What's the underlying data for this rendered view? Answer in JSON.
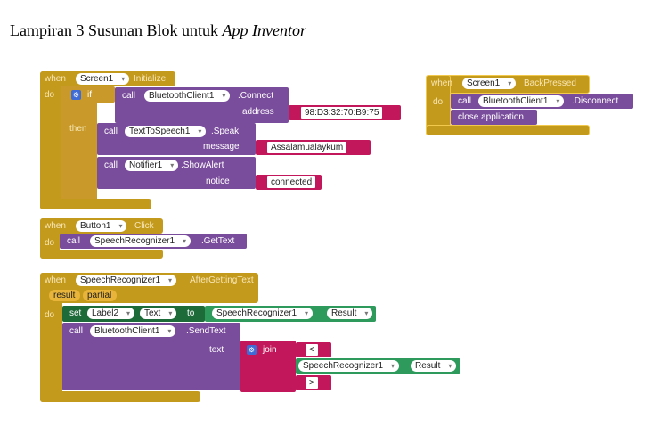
{
  "heading": {
    "prefix": "Lampiran 3 Susunan Blok untuk ",
    "italic": "App Inventor"
  },
  "block_initialize": {
    "when": "when",
    "component": "Screen1",
    "event": "Initialize",
    "do": "do",
    "if": "if",
    "then": "then",
    "connect": {
      "call": "call",
      "component": "BluetoothClient1",
      "method": ".Connect",
      "param": "address",
      "value": "98:D3:32:70:B9:75"
    },
    "speak": {
      "call": "call",
      "component": "TextToSpeech1",
      "method": ".Speak",
      "param": "message",
      "value": "Assalamualaykum"
    },
    "alert": {
      "call": "call",
      "component": "Notifier1",
      "method": ".ShowAlert",
      "param": "notice",
      "value": "connected"
    }
  },
  "block_backpressed": {
    "when": "when",
    "component": "Screen1",
    "event": "BackPressed",
    "do": "do",
    "call": "call",
    "bt_component": "BluetoothClient1",
    "bt_method": ".Disconnect",
    "close": "close application"
  },
  "block_button": {
    "when": "when",
    "component": "Button1",
    "event": "Click",
    "do": "do",
    "call": "call",
    "sr_component": "SpeechRecognizer1",
    "sr_method": ".GetText"
  },
  "block_speech": {
    "when": "when",
    "component": "SpeechRecognizer1",
    "event": "AfterGettingText",
    "param1": "result",
    "param2": "partial",
    "do": "do",
    "set": "set",
    "label": "Label2",
    "prop": "Text",
    "to": "to",
    "sr_component": "SpeechRecognizer1",
    "sr_prop": "Result",
    "call": "call",
    "bt_component": "BluetoothClient1",
    "bt_method": ".SendText",
    "param": "text",
    "join": "join",
    "join_item1": "<",
    "join_item3": ">"
  }
}
